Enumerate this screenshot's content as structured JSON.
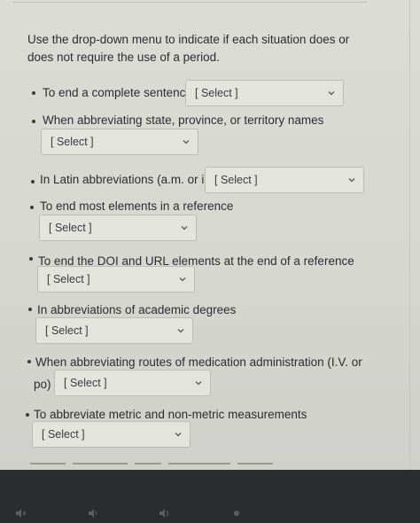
{
  "question": {
    "text": "Use the drop-down menu to indicate if each situation does or does not require the use of a period."
  },
  "items": [
    {
      "label": "To end a complete sentence",
      "selected": "[ Select ]"
    },
    {
      "label": "When abbreviating state, province, or territory names",
      "selected": "[ Select ]"
    },
    {
      "label": "In Latin abbreviations (a.m. or ie)",
      "selected": "[ Select ]"
    },
    {
      "label": "To end most elements in a reference",
      "selected": "[ Select ]"
    },
    {
      "label": "To end the DOI and URL elements at the end of a reference",
      "selected": "[ Select ]"
    },
    {
      "label": "In abbreviations of academic degrees",
      "selected": "[ Select ]"
    },
    {
      "label_line1": "When abbreviating routes of medication administration (I.V. or",
      "label_line2": "po)",
      "selected": "[ Select ]"
    },
    {
      "label": "To abbreviate metric and non-metric measurements",
      "selected": "[ Select ]"
    }
  ],
  "icons": {
    "chevron": "chevron-down-icon",
    "dock": [
      "mute-icon",
      "volume-low-icon",
      "volume-high-icon",
      "brightness-icon"
    ]
  },
  "colors": {
    "page_bg": "#d9d9d4",
    "text": "#2b2c2e",
    "select_bg": "#e4e4df",
    "select_border": "#bcbcb6",
    "dark_bar": "#2b2c2e"
  }
}
